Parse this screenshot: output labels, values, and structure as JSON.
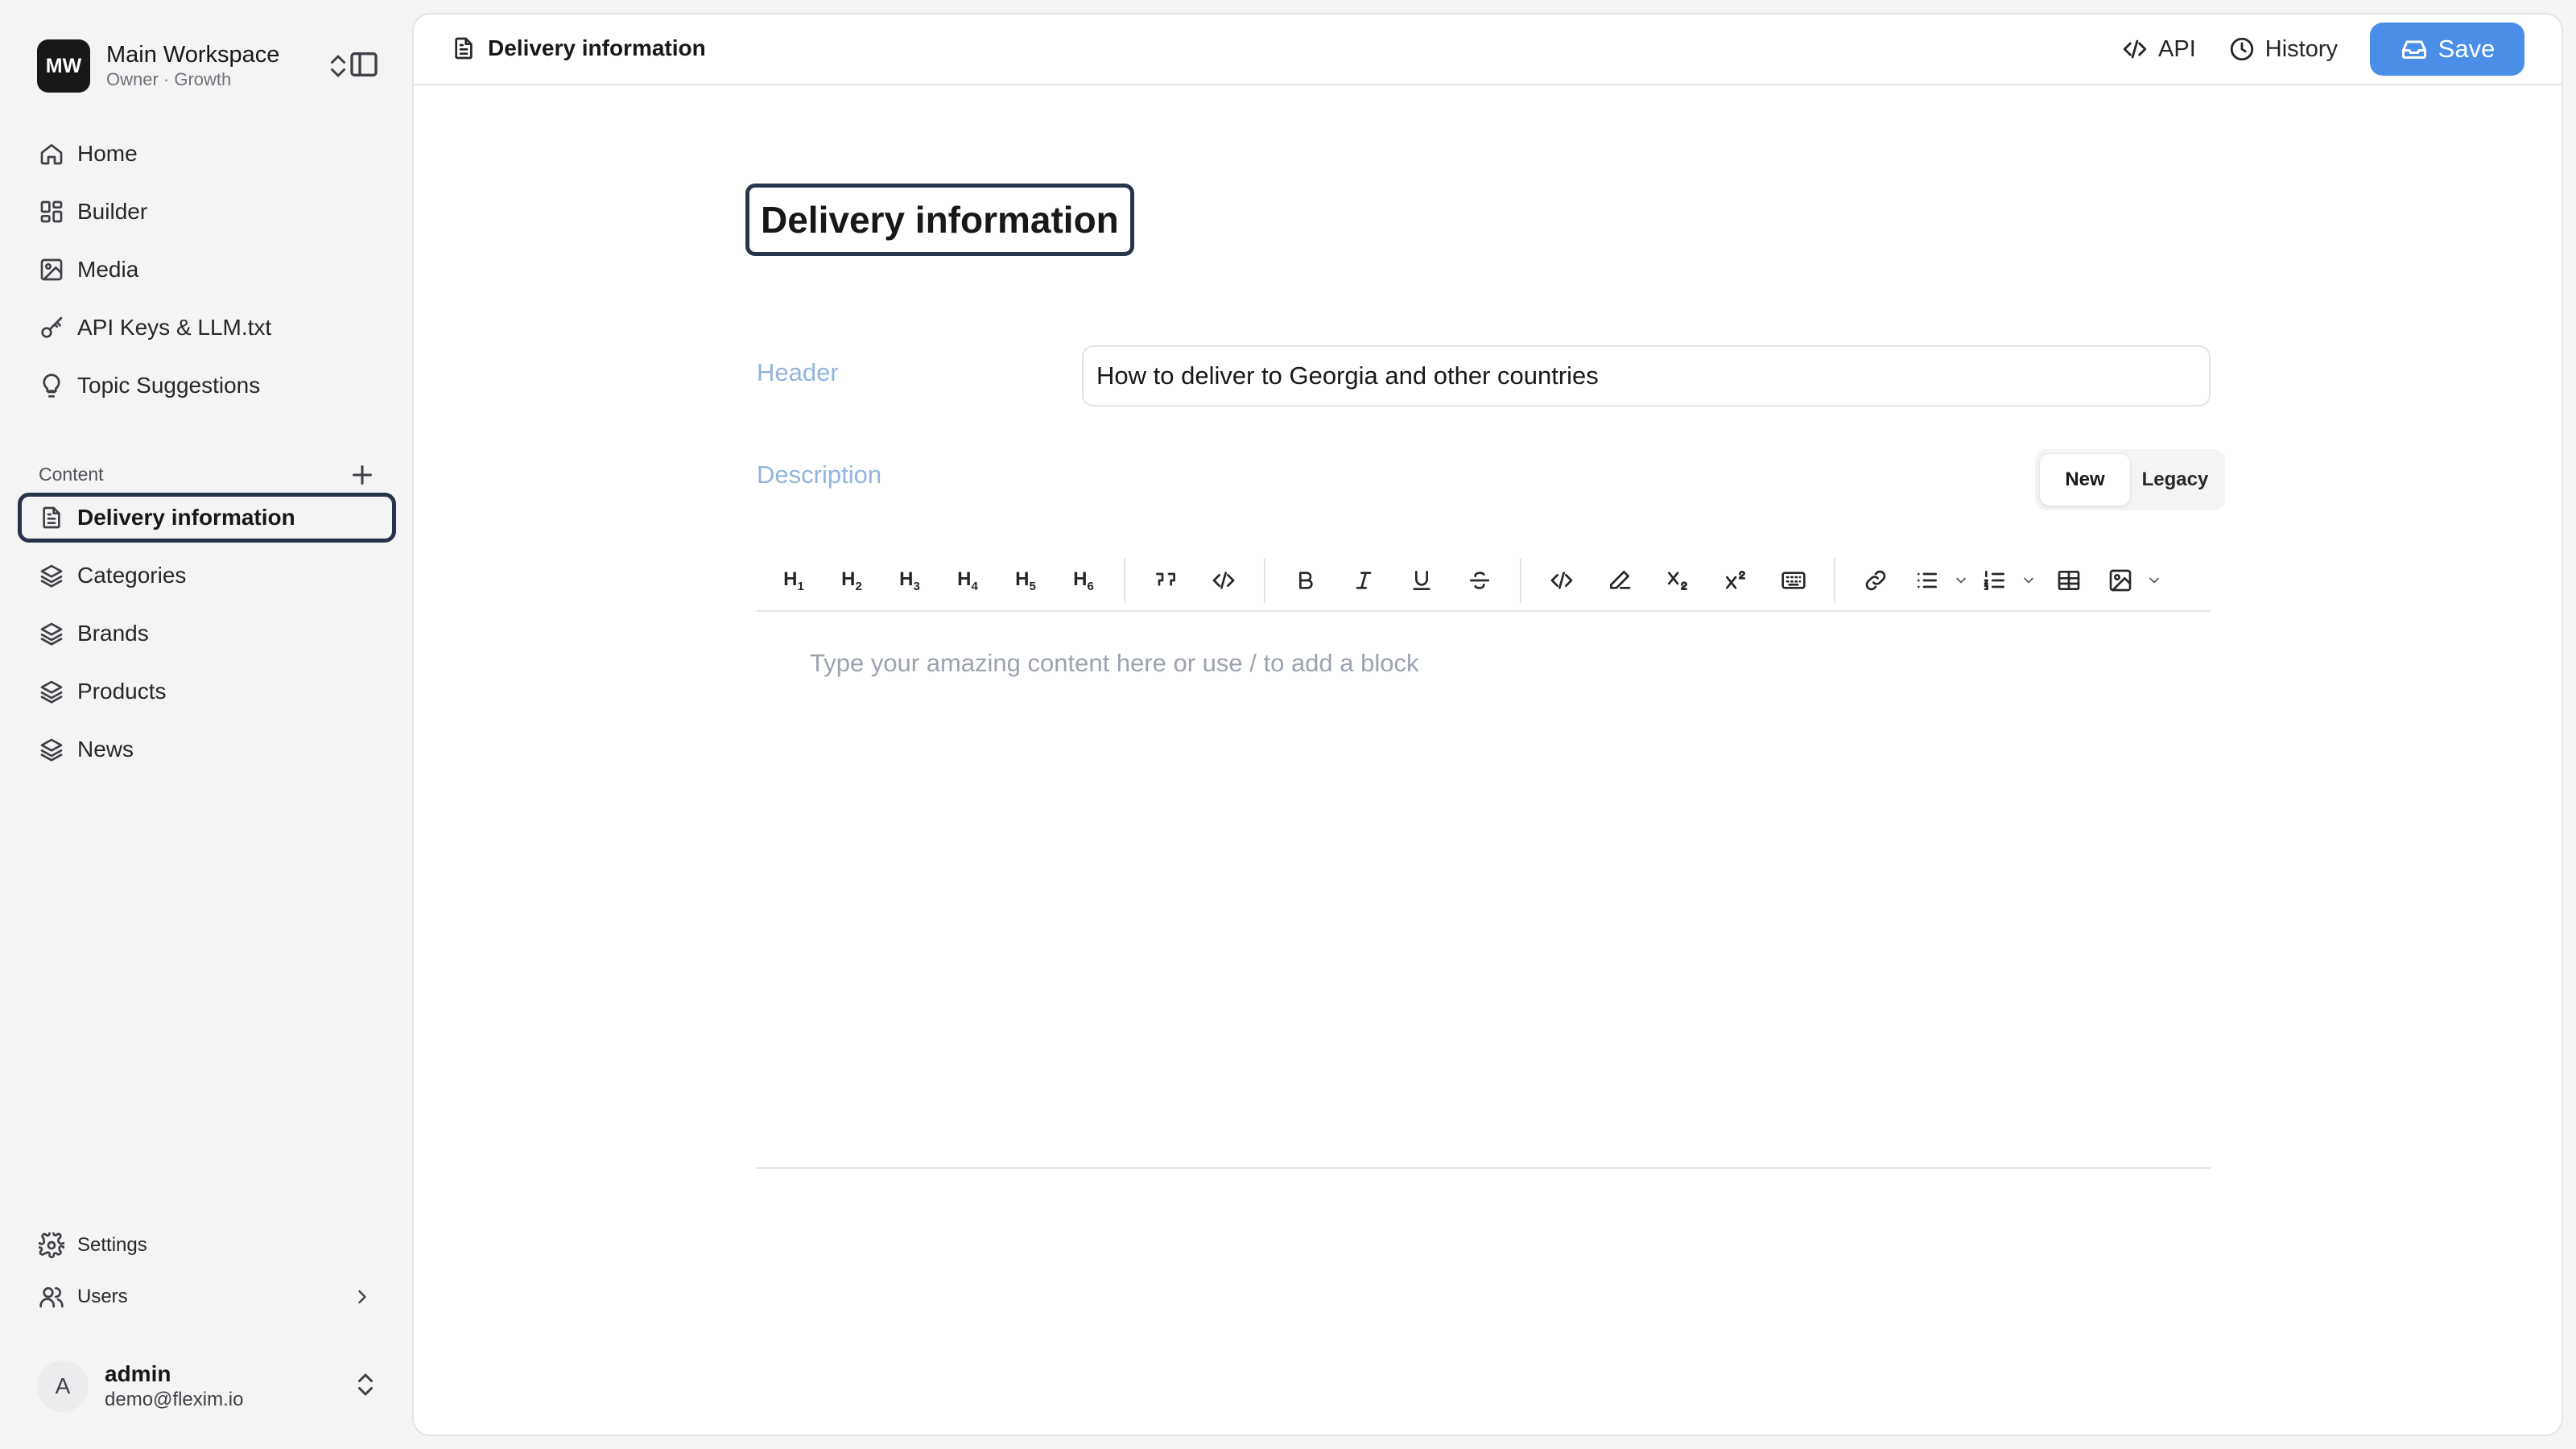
{
  "workspace": {
    "initials": "MW",
    "name": "Main Workspace",
    "subtitle": "Owner · Growth"
  },
  "nav_main": [
    {
      "label": "Home",
      "icon": "home-icon"
    },
    {
      "label": "Builder",
      "icon": "grid-icon"
    },
    {
      "label": "Media",
      "icon": "image-icon"
    },
    {
      "label": "API Keys & LLM.txt",
      "icon": "key-icon"
    },
    {
      "label": "Topic Suggestions",
      "icon": "lightbulb-icon"
    }
  ],
  "content_section": {
    "title": "Content",
    "items": [
      {
        "label": "Delivery information",
        "icon": "document-icon",
        "active": true
      },
      {
        "label": "Categories",
        "icon": "layers-icon"
      },
      {
        "label": "Brands",
        "icon": "layers-icon"
      },
      {
        "label": "Products",
        "icon": "layers-icon"
      },
      {
        "label": "News",
        "icon": "layers-icon"
      }
    ]
  },
  "nav_bottom": {
    "settings": "Settings",
    "users": "Users"
  },
  "user": {
    "initial": "A",
    "name": "admin",
    "email": "demo@flexim.io"
  },
  "topbar": {
    "breadcrumb": "Delivery information",
    "api_label": "API",
    "history_label": "History",
    "save_label": "Save"
  },
  "editor": {
    "title": "Delivery information",
    "header_label": "Header",
    "header_value": "How to deliver to Georgia and other countries",
    "description_label": "Description",
    "mode_options": [
      "New",
      "Legacy"
    ],
    "mode_selected": "New",
    "placeholder": "Type your amazing content here or use / to add a block",
    "headings": [
      "H1",
      "H2",
      "H3",
      "H4",
      "H5",
      "H6"
    ]
  },
  "colors": {
    "accent": "#4a8ee8",
    "active_border": "#27344a",
    "label_color": "#93b4dc"
  }
}
